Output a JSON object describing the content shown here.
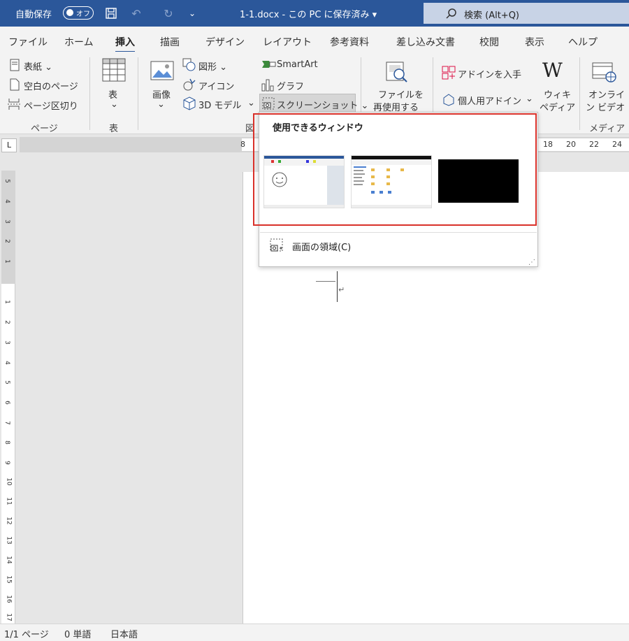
{
  "titlebar": {
    "autosave_label": "自動保存",
    "autosave_state": "オフ",
    "document": "1-1.docx - この PC に保存済み ▾",
    "search_text": "検索 (Alt+Q)"
  },
  "tabs": [
    "ファイル",
    "ホーム",
    "挿入",
    "描画",
    "デザイン",
    "レイアウト",
    "参考資料",
    "差し込み文書",
    "校閲",
    "表示",
    "ヘルプ"
  ],
  "active_tab": "挿入",
  "ribbon": {
    "pages": {
      "cover": "表紙 ⌄",
      "blank": "空白のページ",
      "break": "ページ区切り",
      "label": "ページ"
    },
    "table": {
      "button": "表",
      "caret": "⌄",
      "label": "表"
    },
    "illustrations": {
      "picture": "画像",
      "picture_caret": "⌄",
      "shapes": "図形 ⌄",
      "icons": "アイコン",
      "models": "3D モデル",
      "models_caret": "⌄",
      "smartart": "SmartArt",
      "chart": "グラフ",
      "screenshot": "スクリーンショット ⌄",
      "label": "図"
    },
    "reuse": {
      "line1": "ファイルを",
      "line2": "再使用する"
    },
    "addins": {
      "get": "アドインを入手",
      "my": "個人用アドイン",
      "my_caret": "⌄"
    },
    "wiki": {
      "logo": "W",
      "line1": "ウィキ",
      "line2": "ペディア"
    },
    "media": {
      "line1": "オンライ",
      "line2": "ン ビデオ",
      "label": "メディア"
    }
  },
  "ruler": {
    "corner": "L",
    "h_numbers": [
      "8",
      "18",
      "20",
      "22",
      "24"
    ],
    "v_numbers": [
      "5",
      "4",
      "3",
      "2",
      "1",
      "1",
      "2",
      "3",
      "4",
      "5",
      "6",
      "7",
      "8",
      "9",
      "10",
      "11",
      "12",
      "13",
      "14",
      "15",
      "16",
      "17"
    ]
  },
  "dropdown": {
    "title": "使用できるウィンドウ",
    "item": "画面の領域(C)",
    "windows": [
      "paint-window",
      "explorer-window",
      "black-window"
    ]
  },
  "document": {
    "paragraph_mark": "↵"
  },
  "status": {
    "page": "1/1 ページ",
    "words": "0 単語",
    "language": "日本語"
  },
  "colors": {
    "titlebar": "#2b579a",
    "highlight": "#d9312a"
  }
}
